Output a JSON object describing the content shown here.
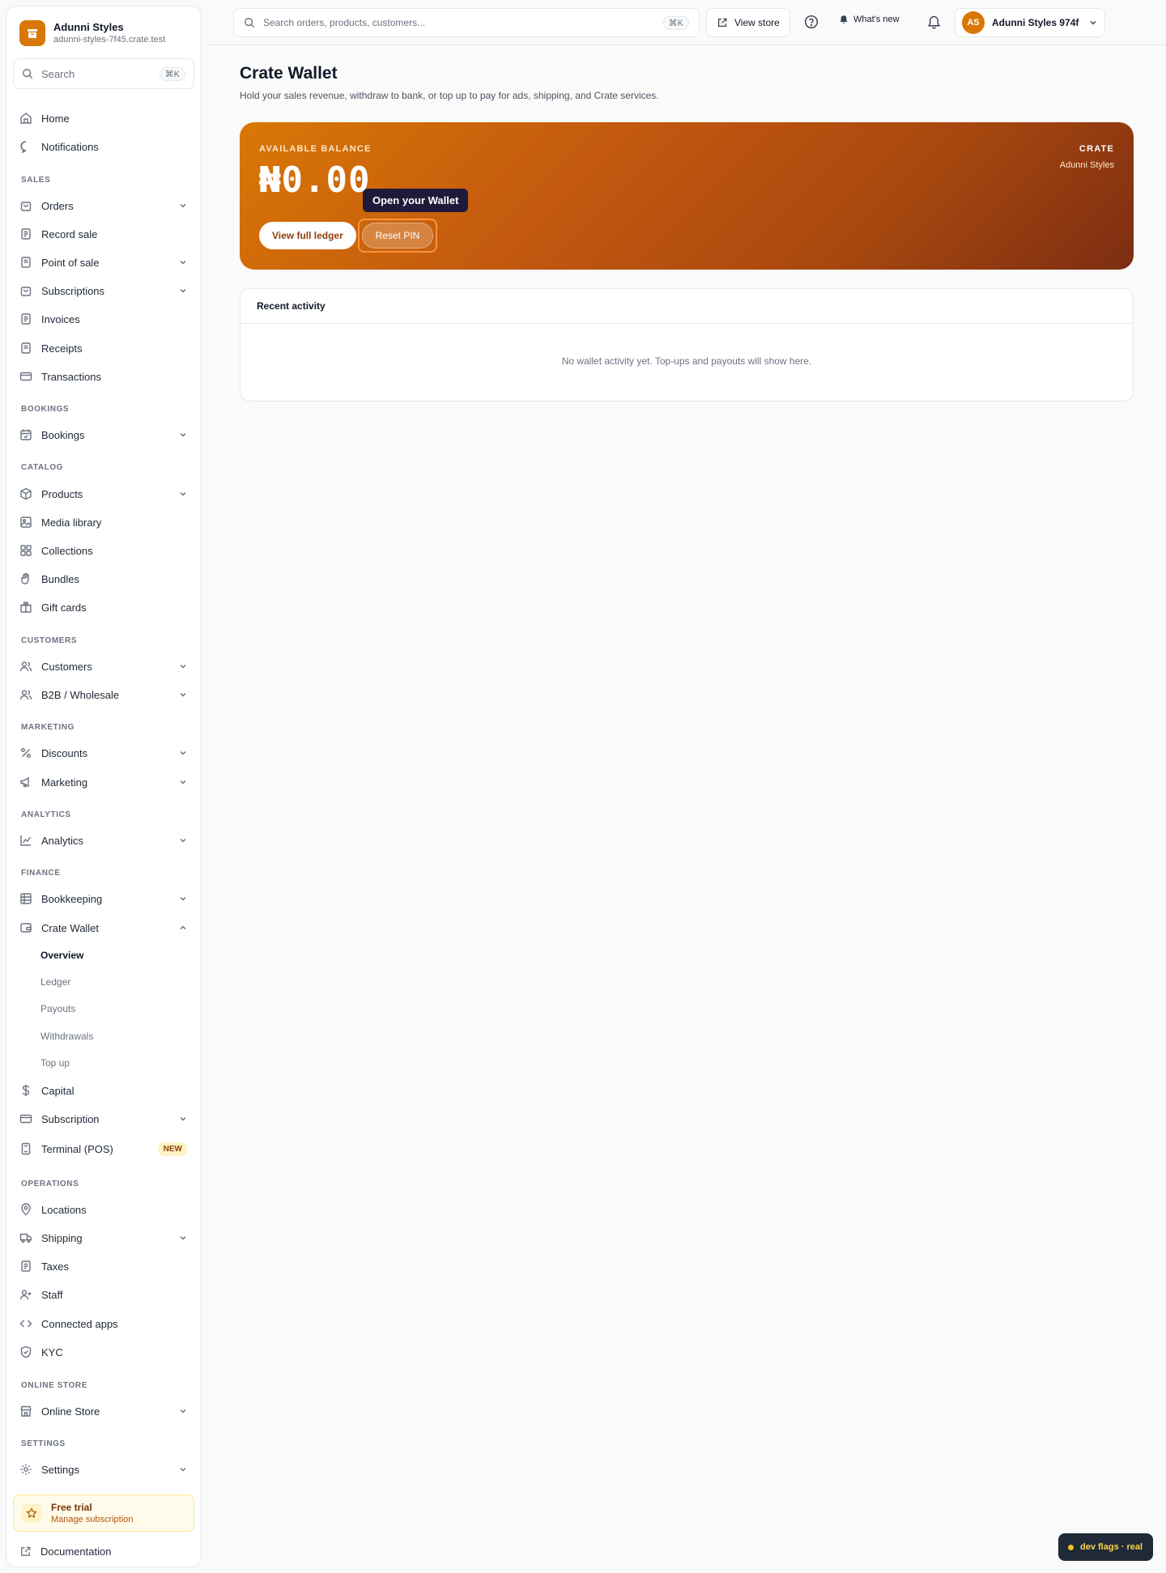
{
  "brand": {
    "name": "Adunni Styles",
    "domain": "adunni-styles-7f45.crate.test"
  },
  "sidebar": {
    "search_label": "Search",
    "search_shortcut": "⌘K",
    "items": {
      "home": "Home",
      "notifications": "Notifications",
      "orders": "Orders",
      "record_sale": "Record sale",
      "point_of_sale": "Point of sale",
      "subscriptions": "Subscriptions",
      "invoices": "Invoices",
      "receipts": "Receipts",
      "transactions": "Transactions",
      "bookings": "Bookings",
      "products": "Products",
      "media_library": "Media library",
      "collections": "Collections",
      "bundles": "Bundles",
      "gift_cards": "Gift cards",
      "customers": "Customers",
      "b2b": "B2B / Wholesale",
      "discounts": "Discounts",
      "marketing": "Marketing",
      "analytics": "Analytics",
      "bookkeeping": "Bookkeeping",
      "crate_wallet": "Crate Wallet",
      "capital": "Capital",
      "subscription": "Subscription",
      "terminal": "Terminal (POS)",
      "locations": "Locations",
      "shipping": "Shipping",
      "taxes": "Taxes",
      "staff": "Staff",
      "connected_apps": "Connected apps",
      "kyc": "KYC",
      "online_store": "Online Store",
      "settings": "Settings"
    },
    "sections": {
      "sales": "SALES",
      "bookings": "BOOKINGS",
      "catalog": "CATALOG",
      "customers": "CUSTOMERS",
      "marketing": "MARKETING",
      "analytics": "ANALYTICS",
      "finance": "FINANCE",
      "operations": "OPERATIONS",
      "online_store": "ONLINE STORE",
      "settings": "SETTINGS"
    },
    "wallet_sub": {
      "overview": "Overview",
      "ledger": "Ledger",
      "payouts": "Payouts",
      "withdrawals": "Withdrawals",
      "top_up": "Top up"
    },
    "new_badge": "NEW",
    "trial": {
      "title": "Free trial",
      "subtitle": "Manage subscription"
    },
    "documentation": "Documentation"
  },
  "topbar": {
    "search_placeholder": "Search orders, products, customers...",
    "search_shortcut": "⌘K",
    "view_store": "View store",
    "whats_new": "What's new",
    "account_initials": "AS",
    "account_name": "Adunni Styles 974f"
  },
  "main": {
    "title": "Crate Wallet",
    "subtitle": "Hold your sales revenue, withdraw to bank, or top up to pay for ads, shipping, and Crate services.",
    "card": {
      "label": "AVAILABLE BALANCE",
      "balance": "₦0.00",
      "brand": "CRATE",
      "store": "Adunni Styles",
      "ledger_button": "View full ledger",
      "pin_button": "Reset PIN"
    },
    "tooltip": "Open your Wallet",
    "activity": {
      "title": "Recent activity",
      "empty": "No wallet activity yet. Top-ups and payouts will show here."
    }
  },
  "devflags": "dev flags · real",
  "colors": {
    "accent": "#d97706",
    "accent_dark": "#7c2d12",
    "tooltip": "#1e1b3a"
  }
}
